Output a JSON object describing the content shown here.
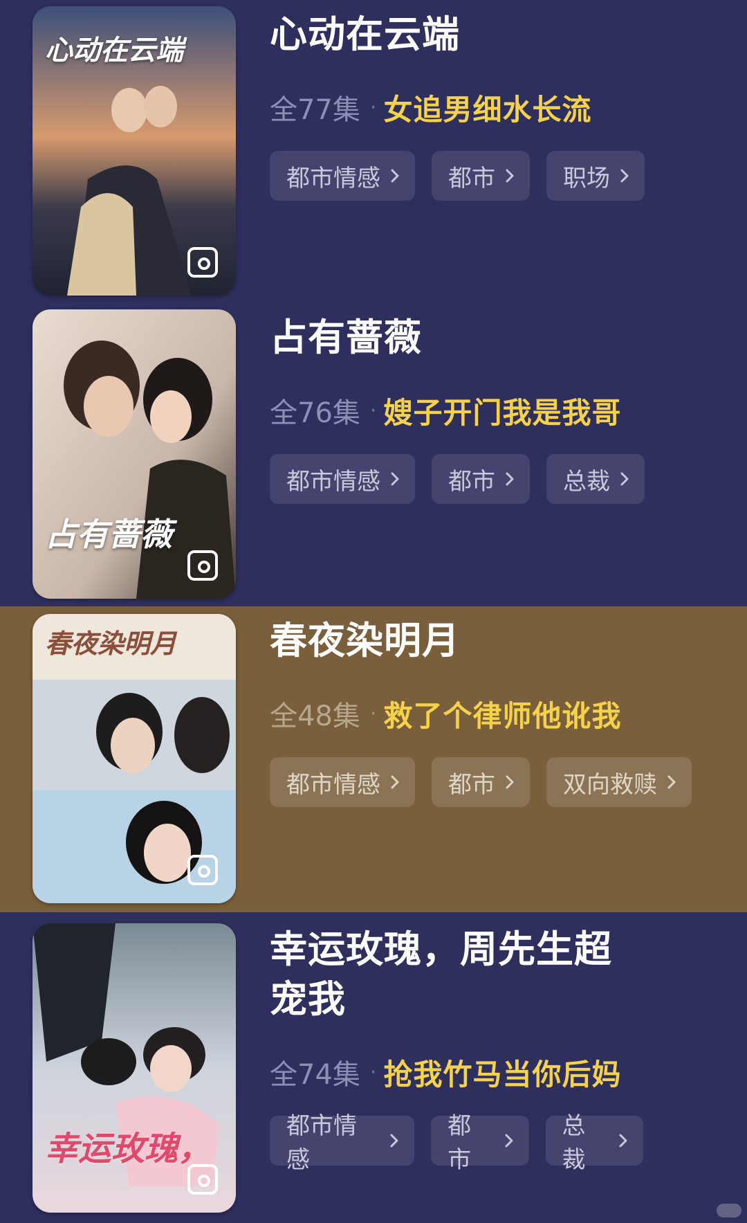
{
  "items": [
    {
      "title": "心动在云端",
      "poster_title": "心动在云端",
      "episodes": "全77集",
      "tagline": "女追男细水长流",
      "tags": [
        "都市情感",
        "都市",
        "职场"
      ]
    },
    {
      "title": "占有蔷薇",
      "poster_title": "占有蔷薇",
      "episodes": "全76集",
      "tagline": "嫂子开门我是我哥",
      "tags": [
        "都市情感",
        "都市",
        "总裁"
      ]
    },
    {
      "title": "春夜染明月",
      "poster_title": "春夜染明月",
      "episodes": "全48集",
      "tagline": "救了个律师他讹我",
      "tags": [
        "都市情感",
        "都市",
        "双向救赎"
      ]
    },
    {
      "title": "幸运玫瑰，周先生超宠我",
      "poster_title": "幸运玫瑰，",
      "episodes": "全74集",
      "tagline": "抢我竹马当你后妈",
      "tags": [
        "都市情感",
        "都市",
        "总裁"
      ]
    }
  ],
  "colors": {
    "card_bg": "#2f2f5e",
    "highlight_bg": "#7a5f3c",
    "tagline": "#f5d24a",
    "episodes": "#8f8fb5"
  },
  "icons": {
    "poster_badge": "picture-in-picture-icon",
    "tag_arrow": "chevron-right-icon"
  }
}
